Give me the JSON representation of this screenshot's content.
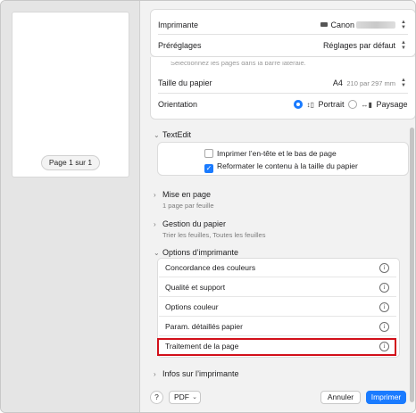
{
  "preview": {
    "page_counter": "Page 1 sur 1"
  },
  "printer": {
    "label": "Imprimante",
    "value": "Canon",
    "presets_label": "Préréglages",
    "presets_value": "Réglages par défaut"
  },
  "pages_hint": "Sélectionnez les pages dans la barre latérale.",
  "paper": {
    "label": "Taille du papier",
    "value": "A4",
    "dims": "210 par 297 mm"
  },
  "orientation": {
    "label": "Orientation",
    "portrait": "Portrait",
    "landscape": "Paysage",
    "selected": "Portrait"
  },
  "textedit": {
    "title": "TextEdit",
    "print_header_footer": "Imprimer l’en-tête et le bas de page",
    "print_header_footer_checked": false,
    "rewrap": "Reformater le contenu à la taille du papier",
    "rewrap_checked": true
  },
  "layout": {
    "title": "Mise en page",
    "summary": "1 page par feuille"
  },
  "paper_handling": {
    "title": "Gestion du papier",
    "summary": "Trier les feuilles, Toutes les feuilles"
  },
  "printer_options": {
    "title": "Options d’imprimante",
    "items": [
      "Concordance des couleurs",
      "Qualité et support",
      "Options couleur",
      "Param. détaillés papier",
      "Traitement de la page"
    ],
    "highlighted": "Traitement de la page"
  },
  "printer_info": {
    "title": "Infos sur l’imprimante"
  },
  "footer": {
    "help": "?",
    "pdf": "PDF",
    "cancel": "Annuler",
    "print": "Imprimer"
  },
  "colors": {
    "accent": "#1a7bff",
    "highlight": "#d2101a"
  }
}
